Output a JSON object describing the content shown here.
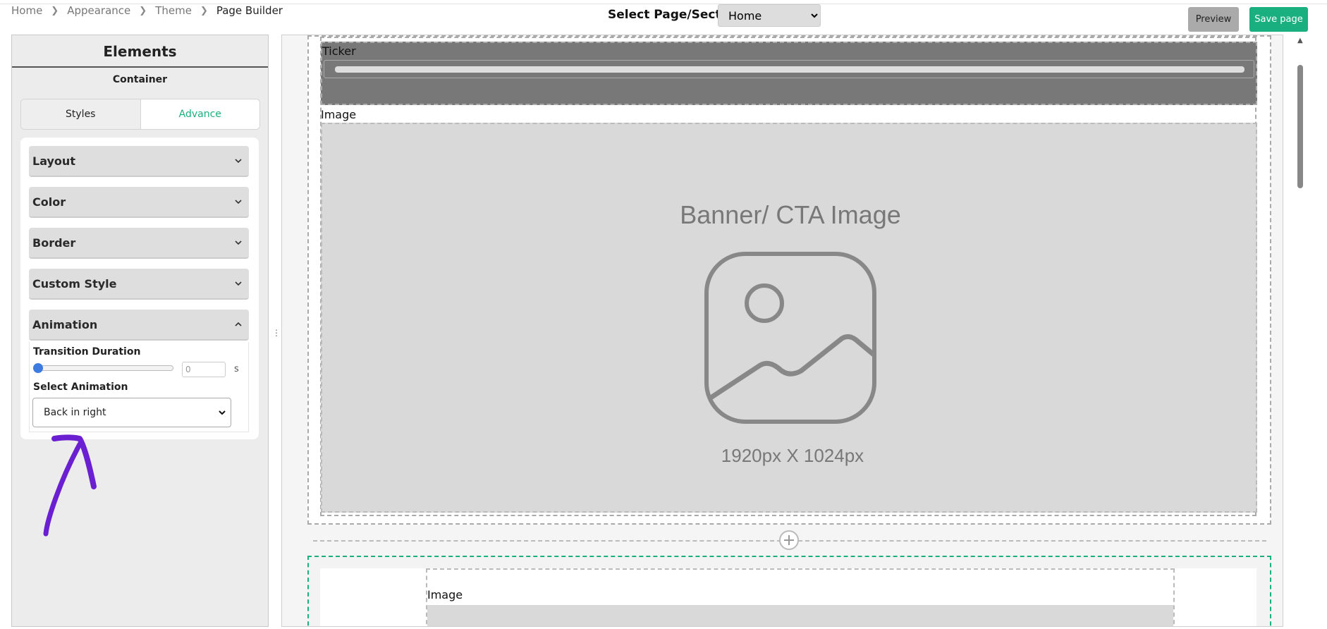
{
  "breadcrumb": {
    "items": [
      "Home",
      "Appearance",
      "Theme"
    ],
    "current": "Page Builder"
  },
  "header": {
    "select_label": "Select Page/Section:",
    "select_value": "Home",
    "preview_label": "Preview",
    "save_label": "Save page"
  },
  "sidebar": {
    "title": "Elements",
    "subtitle": "Container",
    "tabs": [
      {
        "label": "Styles",
        "active": false
      },
      {
        "label": "Advance",
        "active": true
      }
    ],
    "accordions": [
      {
        "label": "Layout",
        "expanded": false
      },
      {
        "label": "Color",
        "expanded": false
      },
      {
        "label": "Border",
        "expanded": false
      },
      {
        "label": "Custom Style",
        "expanded": false
      },
      {
        "label": "Animation",
        "expanded": true
      }
    ],
    "animation": {
      "duration_label": "Transition Duration",
      "duration_value": "0",
      "duration_unit": "s",
      "select_label": "Select Animation",
      "select_value": "Back in right"
    }
  },
  "canvas": {
    "ticker_label": "Ticker",
    "image_label": "Image",
    "banner_title": "Banner/ CTA Image",
    "banner_size": "1920px X 1024px",
    "second_image_label": "Image"
  },
  "toolbar": {
    "tools": [
      "toggle-icon",
      "duplicate-icon",
      "move-up-icon",
      "move-down-icon",
      "drag-move-icon",
      "close-icon"
    ]
  },
  "colors": {
    "accent": "#1aaf7e",
    "annotation": "#6a1fd1"
  }
}
